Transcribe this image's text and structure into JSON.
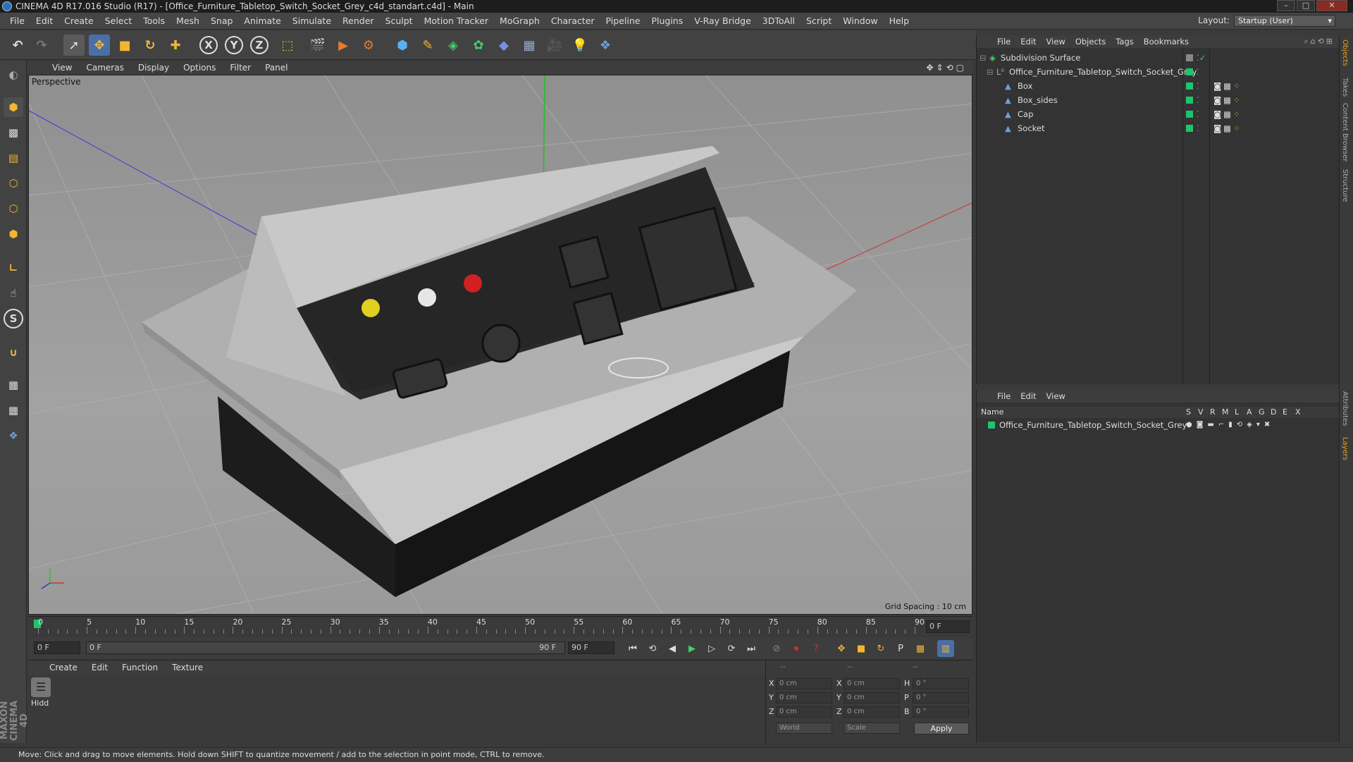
{
  "window": {
    "title": "CINEMA 4D R17.016 Studio (R17) - [Office_Furniture_Tabletop_Switch_Socket_Grey_c4d_standart.c4d] - Main"
  },
  "menu": [
    "File",
    "Edit",
    "Create",
    "Select",
    "Tools",
    "Mesh",
    "Snap",
    "Animate",
    "Simulate",
    "Render",
    "Sculpt",
    "Motion Tracker",
    "MoGraph",
    "Character",
    "Pipeline",
    "Plugins",
    "V-Ray Bridge",
    "3DToAll",
    "Script",
    "Window",
    "Help"
  ],
  "layout": {
    "label": "Layout:",
    "value": "Startup (User)"
  },
  "toolbar": {
    "x_label": "X",
    "y_label": "Y",
    "z_label": "Z"
  },
  "viewport": {
    "menu": [
      "View",
      "Cameras",
      "Display",
      "Options",
      "Filter",
      "Panel"
    ],
    "label": "Perspective",
    "grid_spacing": "Grid Spacing : 10 cm"
  },
  "timeline": {
    "ticks": [
      "0",
      "5",
      "10",
      "15",
      "20",
      "25",
      "30",
      "35",
      "40",
      "45",
      "50",
      "55",
      "60",
      "65",
      "70",
      "75",
      "80",
      "85",
      "90"
    ],
    "current_frame_field": "0 F",
    "start_field": "0 F",
    "range_start": "0 F",
    "range_end": "90 F",
    "end_field": "90 F"
  },
  "material_manager": {
    "menu": [
      "Create",
      "Edit",
      "Function",
      "Texture"
    ],
    "material_name": "Hidd"
  },
  "coordinates": {
    "header": [
      "--",
      "--",
      "--"
    ],
    "rows": [
      {
        "a": "X",
        "av": "0 cm",
        "b": "X",
        "bv": "0 cm",
        "c": "H",
        "cv": "0 °"
      },
      {
        "a": "Y",
        "av": "0 cm",
        "b": "Y",
        "bv": "0 cm",
        "c": "P",
        "cv": "0 °"
      },
      {
        "a": "Z",
        "av": "0 cm",
        "b": "Z",
        "bv": "0 cm",
        "c": "B",
        "cv": "0 °"
      }
    ],
    "world": "World",
    "scale": "Scale",
    "apply": "Apply"
  },
  "object_manager": {
    "menu": [
      "File",
      "Edit",
      "View",
      "Objects",
      "Tags",
      "Bookmarks"
    ],
    "objects": [
      {
        "name": "Subdivision Surface",
        "indent": 0
      },
      {
        "name": "Office_Furniture_Tabletop_Switch_Socket_Grey",
        "indent": 1
      },
      {
        "name": "Box",
        "indent": 2
      },
      {
        "name": "Box_sides",
        "indent": 2
      },
      {
        "name": "Cap",
        "indent": 2
      },
      {
        "name": "Socket",
        "indent": 2
      }
    ]
  },
  "layer_manager": {
    "menu": [
      "File",
      "Edit",
      "View"
    ],
    "columns": [
      "Name",
      "S",
      "V",
      "R",
      "M",
      "L",
      "A",
      "G",
      "D",
      "E",
      "X"
    ],
    "layers": [
      {
        "name": "Office_Furniture_Tabletop_Switch_Socket_Grey",
        "color": "#1fc46b"
      }
    ]
  },
  "right_tabs": [
    "Objects",
    "Takes",
    "Content Browser",
    "Structure",
    "Attributes",
    "Layers"
  ],
  "brand": "MAXON CINEMA 4D",
  "status": "Move: Click and drag to move elements. Hold down SHIFT to quantize movement / add to the selection in point mode, CTRL to remove.",
  "colors": {
    "accent": "#3f7fd0",
    "green": "#1fc46b"
  }
}
